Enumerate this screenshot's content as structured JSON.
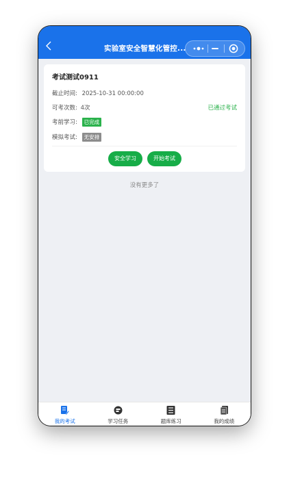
{
  "header": {
    "title": "实验室安全智慧化管控...",
    "back_icon": "chevron-left-icon"
  },
  "exam_card": {
    "title": "考试测试0911",
    "deadline_label": "截止时间:",
    "deadline_value": "2025-10-31 00:00:00",
    "attempts_label": "可考次数:",
    "attempts_value": "4次",
    "status": "已通过考试",
    "pre_study_label": "考前学习:",
    "pre_study_tag": "已完成",
    "mock_label": "模拟考试:",
    "mock_tag": "无安排",
    "study_button": "安全学习",
    "start_button": "开始考试"
  },
  "list_end_text": "没有更多了",
  "tabs": [
    {
      "label": "我的考试",
      "icon": "exam-edit-icon"
    },
    {
      "label": "学习任务",
      "icon": "task-icon"
    },
    {
      "label": "题库练习",
      "icon": "question-bank-icon"
    },
    {
      "label": "我的成绩",
      "icon": "score-report-icon"
    }
  ],
  "colors": {
    "primary": "#1a72ea",
    "success": "#2bb24c",
    "button": "#17ad48",
    "muted_tag": "#8c8c8c",
    "background": "#eef0f4"
  }
}
